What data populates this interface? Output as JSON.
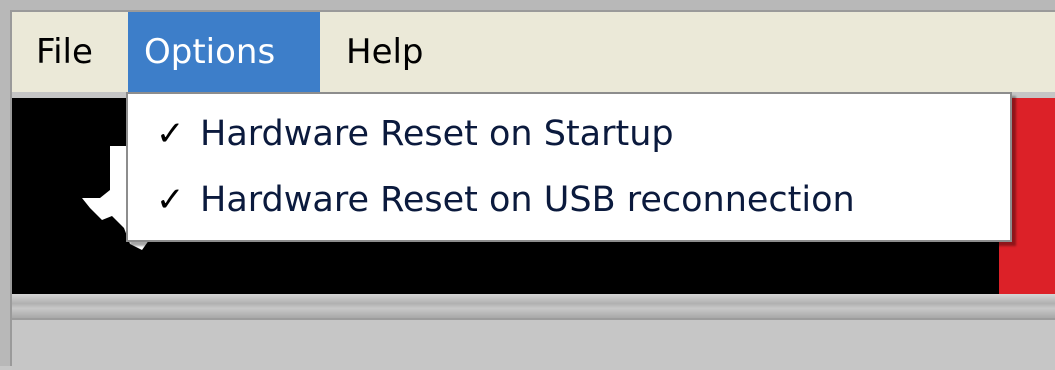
{
  "menubar": {
    "file_label": "File",
    "options_label": "Options",
    "help_label": "Help"
  },
  "options_menu": {
    "items": [
      {
        "label": "Hardware Reset on Startup",
        "checked": true,
        "check_glyph": "✓"
      },
      {
        "label": "Hardware Reset on USB reconnection",
        "checked": true,
        "check_glyph": "✓"
      }
    ]
  },
  "colors": {
    "menu_highlight": "#3d7ec9",
    "banner_background": "#000000",
    "banner_accent": "#dc2128",
    "menubar_background": "#ebe9d8"
  },
  "icons": {
    "logo": "texas-logo-icon",
    "checkmark": "checkmark-icon"
  }
}
